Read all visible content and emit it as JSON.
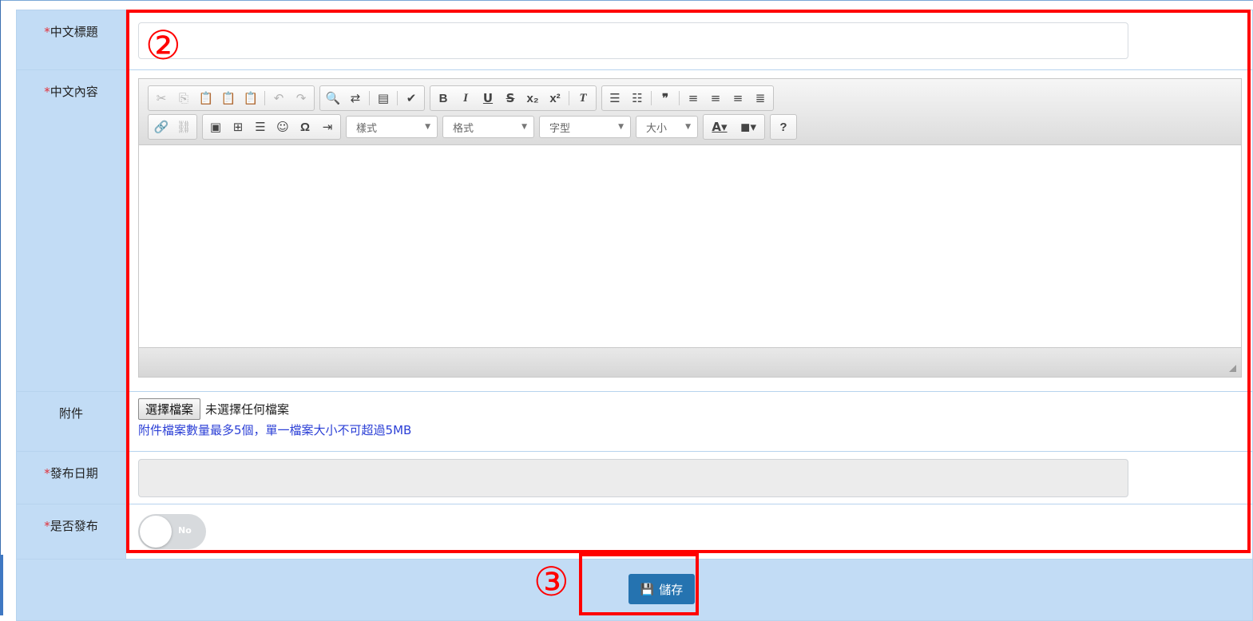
{
  "form": {
    "title_label": "中文標題",
    "content_label": "中文內容",
    "attachment_label": "附件",
    "publish_date_label": "發布日期",
    "is_published_label": "是否發布",
    "required_mark": "*"
  },
  "editor": {
    "combos": {
      "styles": "樣式",
      "format": "格式",
      "font": "字型",
      "size": "大小"
    },
    "icons": {
      "cut": "cut-icon",
      "copy": "copy-icon",
      "paste": "paste-icon",
      "paste_text": "paste-text-icon",
      "paste_word": "paste-word-icon",
      "undo": "undo-icon",
      "redo": "redo-icon",
      "find": "find-icon",
      "replace": "replace-icon",
      "select_all": "select-all-icon",
      "spellcheck": "spellcheck-icon",
      "bold": "bold-icon",
      "italic": "italic-icon",
      "underline": "underline-icon",
      "strike": "strikethrough-icon",
      "subscript": "subscript-icon",
      "superscript": "superscript-icon",
      "remove_format": "remove-format-icon",
      "numbered_list": "numbered-list-icon",
      "bulleted_list": "bulleted-list-icon",
      "blockquote": "blockquote-icon",
      "align_left": "align-left-icon",
      "align_center": "align-center-icon",
      "align_right": "align-right-icon",
      "justify": "justify-icon",
      "link": "link-icon",
      "unlink": "unlink-icon",
      "image": "image-icon",
      "table": "table-icon",
      "hr": "horizontal-rule-icon",
      "smiley": "smiley-icon",
      "special_char": "special-char-icon",
      "page_break": "page-break-icon",
      "text_color": "text-color-icon",
      "bg_color": "bg-color-icon",
      "help": "help-icon"
    }
  },
  "attachment": {
    "choose_button": "選擇檔案",
    "no_file": "未選擇任何檔案",
    "hint": "附件檔案數量最多5個，單一檔案大小不可超過5MB"
  },
  "toggle": {
    "state_text": "No"
  },
  "actions": {
    "save_label": "儲存"
  },
  "annotations": {
    "marker_2": "②",
    "marker_3": "③"
  },
  "colors": {
    "label_bg": "#c2dcf5",
    "required": "#e0303a",
    "save_button": "#2573b0",
    "hint_text": "#2b3fd6",
    "annotation": "#ff0000"
  }
}
